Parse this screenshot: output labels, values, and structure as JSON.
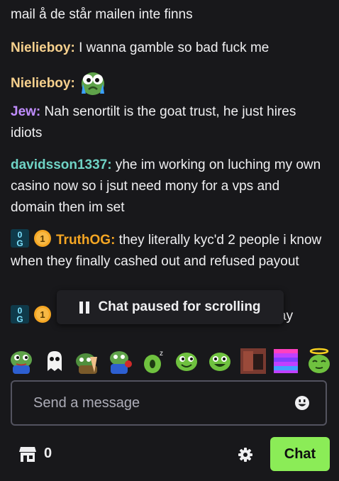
{
  "messages": [
    {
      "user": "",
      "text": "mail å de står mailen inte finns",
      "color": "#efeff1"
    },
    {
      "user": "Nielieboy",
      "sep": ":",
      "text": " I wanna gamble so bad fuck me",
      "color": "#f6d08d"
    },
    {
      "user": "Nielieboy",
      "sep": ":",
      "text": "",
      "color": "#f6d08d",
      "emote": "crying-pepe-emote"
    },
    {
      "user": "Jew",
      "sep": ":",
      "text": " Nah senortilt is the goat trust, he just hires idiots",
      "color": "#c08dff"
    },
    {
      "user": "davidsson1337",
      "sep": ":",
      "text": " yhe im working on luching my own casino now so i jsut need mony for a vps and domain then im set",
      "color": "#6fd3c5"
    },
    {
      "user": "TruthOG",
      "sep": ":",
      "text": " they literally kyc'd 2 people i know when they finally cashed out and refused payout",
      "color": "#f5a623",
      "badges": [
        "og-badge-icon",
        "gold-1-badge-icon"
      ]
    },
    {
      "user": "",
      "text": "ay",
      "color": "#efeff1",
      "badges": [
        "og-badge-icon",
        "gold-1-badge-icon"
      ]
    }
  ],
  "pause_banner": {
    "label": "Chat paused for scrolling"
  },
  "emote_bar": [
    "pepe-emote",
    "ghost-emote",
    "praying-pepe-emote",
    "rose-pepe-emote",
    "sleepy-frog-emote",
    "happy-frog-emote",
    "grinning-frog-emote",
    "photo-emote",
    "pixel-grid-emote",
    "angel-frog-emote"
  ],
  "input": {
    "placeholder": "Send a message"
  },
  "footer": {
    "points": "0",
    "chat_button": "Chat"
  },
  "colors": {
    "accent": "#8bec57",
    "background": "#18181b"
  }
}
